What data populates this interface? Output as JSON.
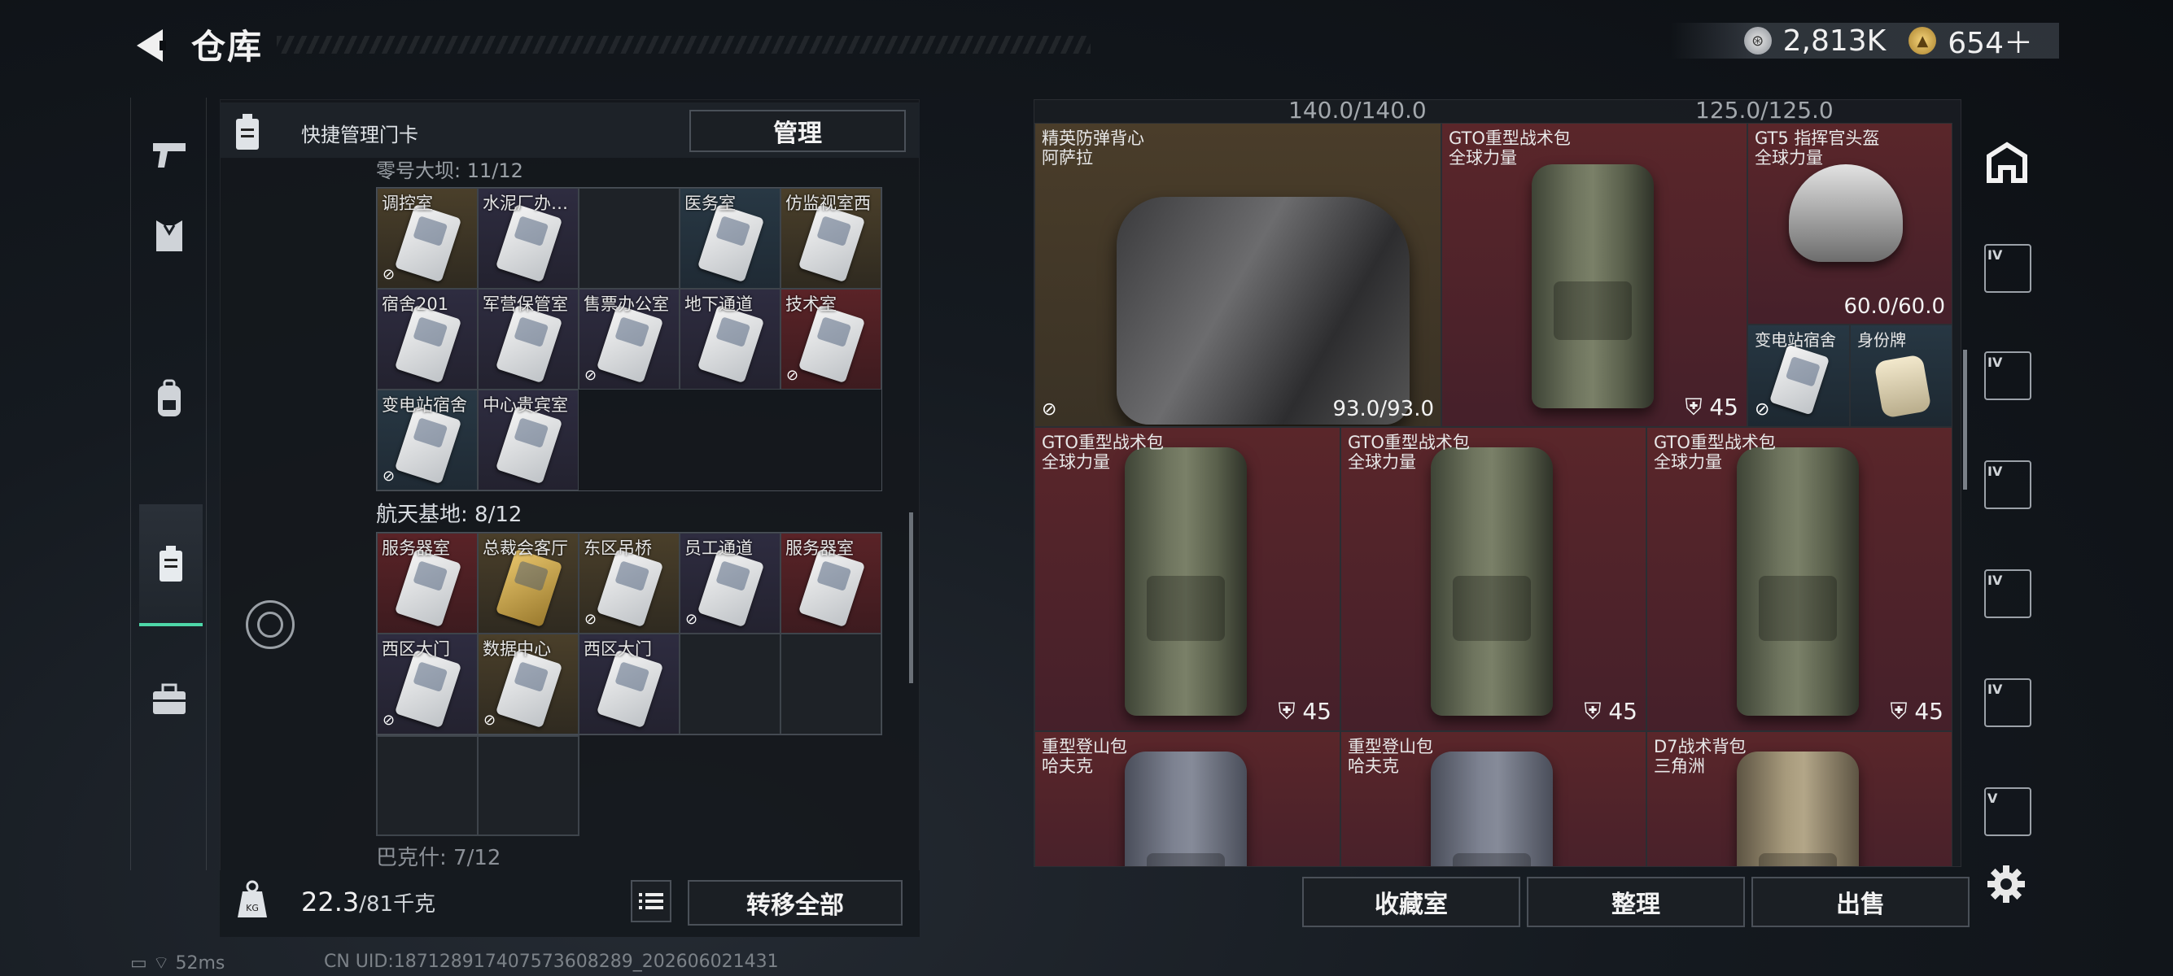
{
  "header": {
    "title": "仓库",
    "currency1": "2,813K",
    "currency2": "654＋"
  },
  "rail": {
    "items": [
      "pistol-icon",
      "vest-icon",
      "backpack-icon",
      "keycard-case-icon",
      "briefcase-icon"
    ]
  },
  "left_panel": {
    "top_label": "快捷管理门卡",
    "manage_button": "管理",
    "section1_label": "零号大坝: 11/12",
    "section1_cells": [
      {
        "label": "调控室",
        "color": "yel",
        "locked": true
      },
      {
        "label": "水泥厂办…",
        "color": "pur",
        "locked": false
      },
      {
        "label": "",
        "color": "empty",
        "locked": false
      },
      {
        "label": "医务室",
        "color": "blu",
        "locked": false
      },
      {
        "label": "仿监视室西",
        "color": "yel",
        "locked": false
      },
      {
        "label": "宿舍201",
        "color": "pur",
        "locked": false
      },
      {
        "label": "军营保管室",
        "color": "pur",
        "locked": false
      },
      {
        "label": "售票办公室",
        "color": "pur",
        "locked": true
      },
      {
        "label": "地下通道",
        "color": "pur",
        "locked": false
      },
      {
        "label": "技术室",
        "color": "red",
        "locked": true
      },
      {
        "label": "变电站宿舍",
        "color": "blu",
        "locked": true
      },
      {
        "label": "中心贵宾室",
        "color": "pur",
        "locked": false
      }
    ],
    "section2_label": "航天基地: 8/12",
    "section2_cells": [
      {
        "label": "服务器室",
        "color": "red",
        "locked": false
      },
      {
        "label": "总裁会客厅",
        "color": "yel",
        "locked": false,
        "gold": true
      },
      {
        "label": "东区吊桥",
        "color": "yel",
        "locked": true
      },
      {
        "label": "员工通道",
        "color": "pur",
        "locked": true
      },
      {
        "label": "服务器室",
        "color": "red",
        "locked": false
      },
      {
        "label": "西区大门",
        "color": "pur",
        "locked": true
      },
      {
        "label": "数据中心",
        "color": "yel",
        "locked": true
      },
      {
        "label": "西区大门",
        "color": "pur",
        "locked": false
      },
      {
        "label": "",
        "color": "empty",
        "locked": false
      },
      {
        "label": "",
        "color": "empty",
        "locked": false
      }
    ],
    "section3_label": "巴克什: 7/12",
    "weight_value": "22.3",
    "weight_unit": "/81千克",
    "transfer_all_button": "转移全部"
  },
  "right_panel": {
    "top_partial1": "140.0/140.0",
    "top_partial2": "125.0/125.0",
    "items": [
      {
        "name": "精英防弹背心",
        "brand": "阿萨拉",
        "value": "93.0/93.0",
        "kind": "vest"
      },
      {
        "name": "GTO重型战术包",
        "brand": "全球力量",
        "value": "45",
        "kind": "pack"
      },
      {
        "name": "GT5 指挥官头盔",
        "brand": "全球力量",
        "value": "60.0/60.0",
        "kind": "helmet"
      },
      {
        "name": "变电站宿舍",
        "brand": "",
        "value": "",
        "kind": "card"
      },
      {
        "name": "身份牌",
        "brand": "",
        "value": "",
        "kind": "tag"
      },
      {
        "name": "GTO重型战术包",
        "brand": "全球力量",
        "value": "45",
        "kind": "pack"
      },
      {
        "name": "GTO重型战术包",
        "brand": "全球力量",
        "value": "45",
        "kind": "pack"
      },
      {
        "name": "GTO重型战术包",
        "brand": "全球力量",
        "value": "45",
        "kind": "pack"
      },
      {
        "name": "重型登山包",
        "brand": "哈夫克",
        "value": "",
        "kind": "grey"
      },
      {
        "name": "重型登山包",
        "brand": "哈夫克",
        "value": "",
        "kind": "grey"
      },
      {
        "name": "D7战术背包",
        "brand": "三角洲",
        "value": "",
        "kind": "tan"
      }
    ],
    "collection_button": "收藏室",
    "sort_button": "整理",
    "sell_button": "出售"
  },
  "right_rail": {
    "items": [
      "IV",
      "IV",
      "IV",
      "IV",
      "IV",
      "V"
    ]
  },
  "status": {
    "ping": "52ms",
    "uid": "CN UID:18712891740757360​8289_202606021431"
  }
}
